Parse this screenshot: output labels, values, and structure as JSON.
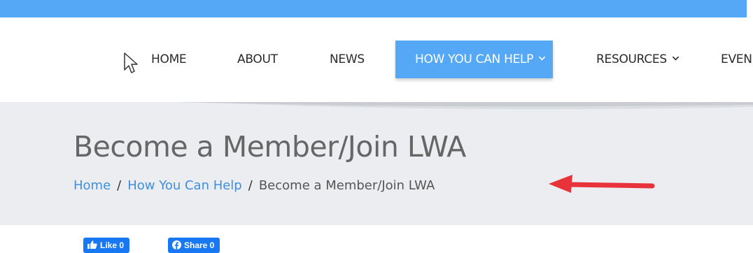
{
  "colors": {
    "accent": "#54a8f5",
    "link": "#3d8fe0",
    "hero_bg": "#ebedf0",
    "annotation_arrow": "#e8333a",
    "facebook": "#1877f2"
  },
  "nav": {
    "items": [
      {
        "label": "HOME"
      },
      {
        "label": "ABOUT"
      },
      {
        "label": "NEWS"
      },
      {
        "label": "HOW YOU CAN HELP",
        "active": true,
        "dropdown": true
      },
      {
        "label": "RESOURCES",
        "dropdown": true
      },
      {
        "label": "EVEN"
      }
    ]
  },
  "hero": {
    "title": "Become a Member/Join LWA",
    "breadcrumb": {
      "home": "Home",
      "parent": "How You Can Help",
      "current": "Become a Member/Join LWA",
      "separator": "/"
    }
  },
  "social": {
    "like_label": "Like 0",
    "share_label": "Share 0"
  },
  "icons": [
    "pointer-cursor-icon",
    "chevron-down-icon",
    "thumbs-up-icon",
    "facebook-icon",
    "red-arrow-annotation"
  ]
}
